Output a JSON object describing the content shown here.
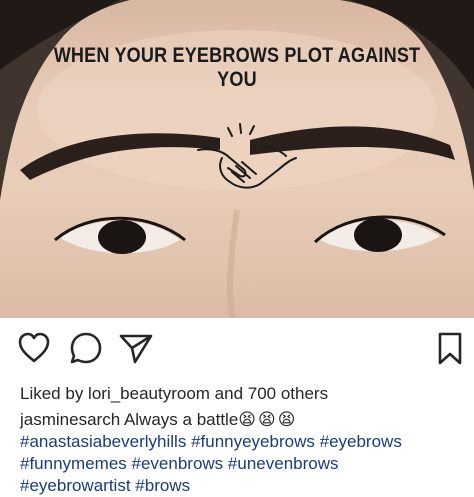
{
  "post": {
    "image_caption": "WHEN YOUR EYEBROWS PLOT AGAINST YOU",
    "liked_by_prefix": "Liked by ",
    "liked_by_user": "lori_beautyroom",
    "liked_by_suffix": " and 700 others",
    "author": "jasminesarch",
    "caption_text": " Always a battle",
    "caption_emojis": "😫😫😫",
    "hashtags_line1": [
      "#anastasiabeverlyhills",
      "#funnyeyebrows",
      "#eyebrows"
    ],
    "hashtags_line2": [
      "#funnymemes",
      "#evenbrows",
      "#unevenbrows"
    ],
    "hashtags_line3": [
      "#eyebrowartist",
      "#brows"
    ]
  },
  "actions": {
    "like_icon": "heart-icon",
    "comment_icon": "comment-bubble-icon",
    "share_icon": "paper-plane-icon",
    "save_icon": "bookmark-icon"
  },
  "colors": {
    "hashtag": "#1c3d73",
    "text": "#262626"
  }
}
